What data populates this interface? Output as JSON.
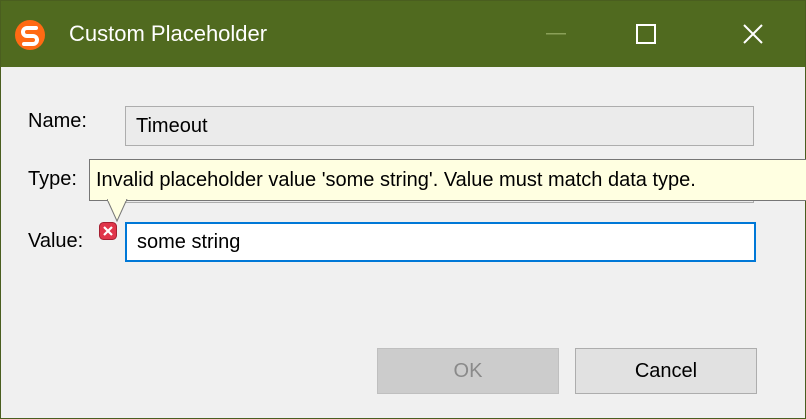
{
  "window": {
    "title": "Custom Placeholder",
    "titlebar_color": "#506a1f",
    "app_icon": "app-logo-icon",
    "controls": {
      "minimize_icon": "minimize-icon",
      "maximize_icon": "maximize-icon",
      "close_icon": "close-icon"
    }
  },
  "form": {
    "name_label": "Name:",
    "name_value": "Timeout",
    "type_label": "Type:",
    "value_label": "Value:",
    "value_value": "some string"
  },
  "validation": {
    "icon": "error-icon",
    "tooltip": "Invalid placeholder value 'some string'. Value must match data type."
  },
  "buttons": {
    "ok_label": "OK",
    "ok_enabled": false,
    "cancel_label": "Cancel"
  }
}
